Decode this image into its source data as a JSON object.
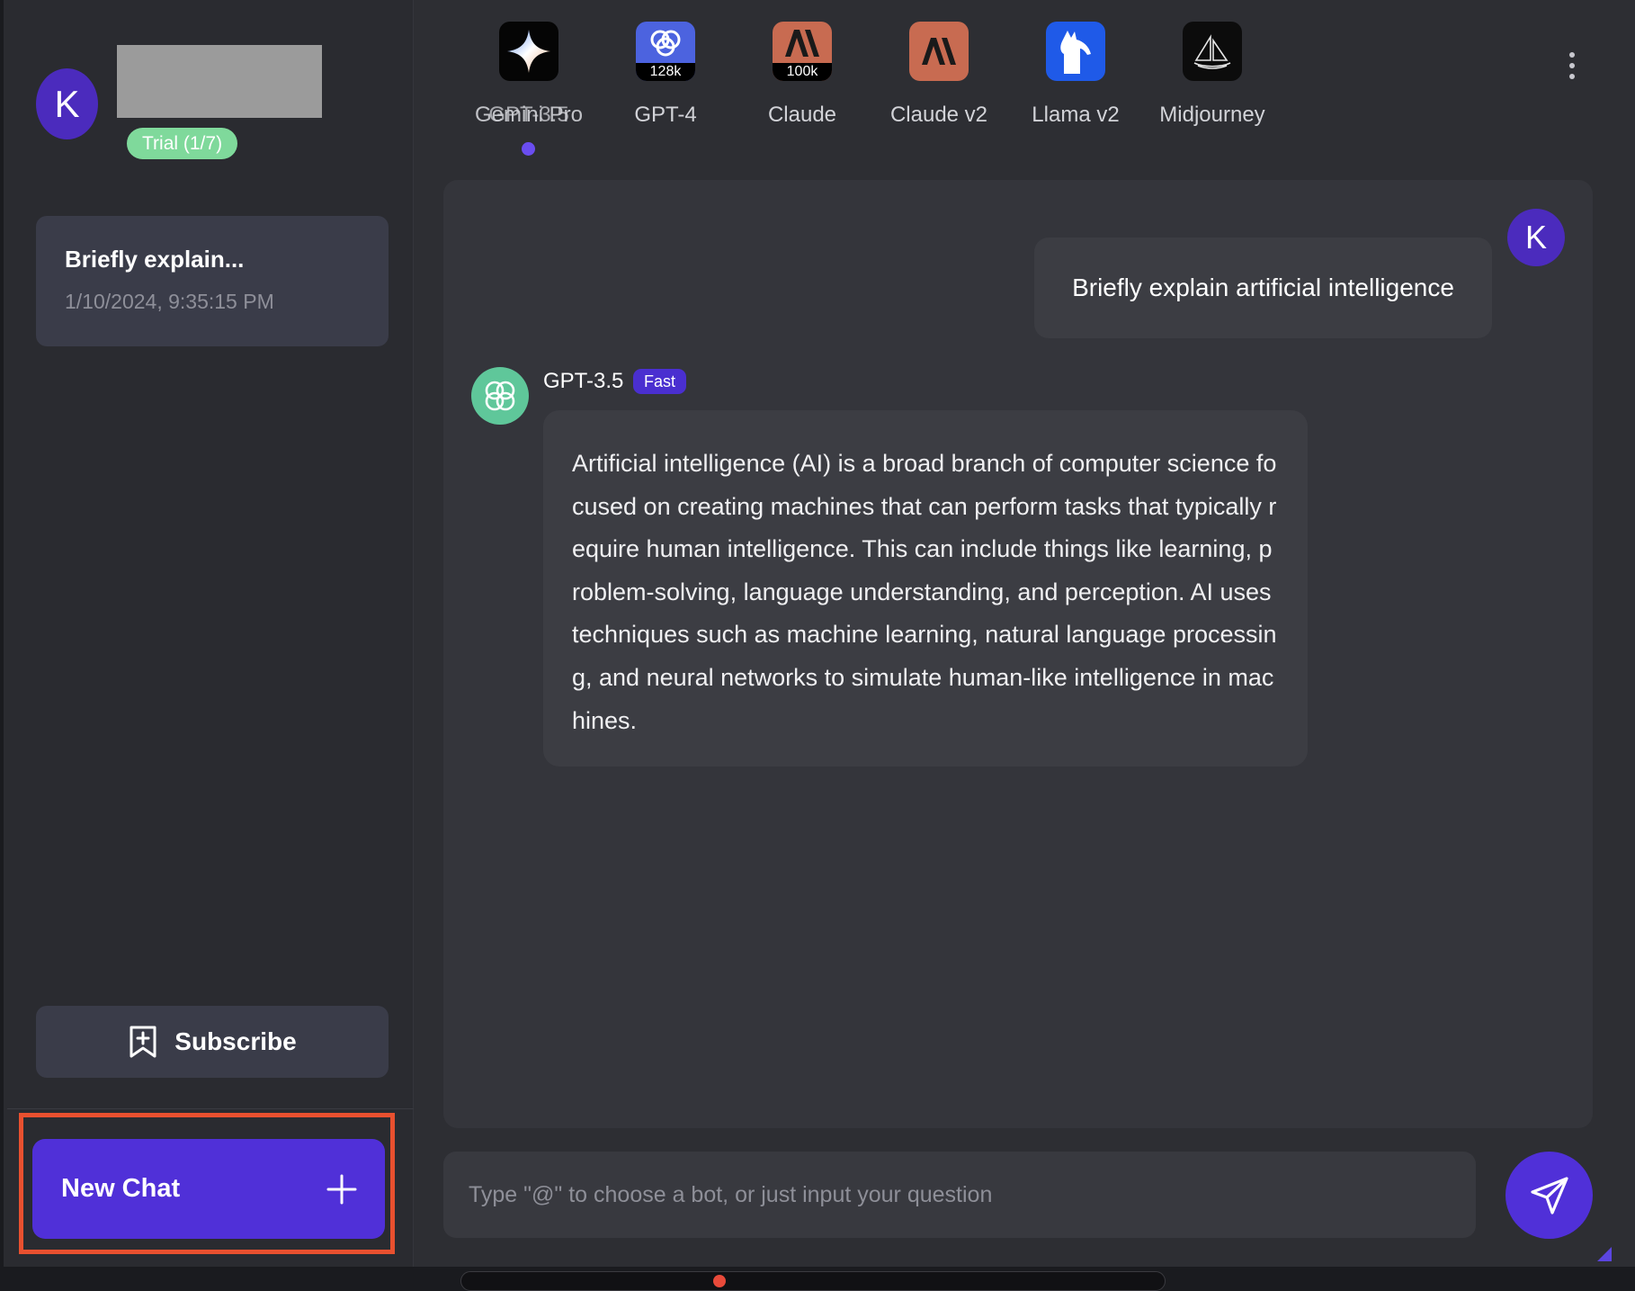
{
  "colors": {
    "accent": "#5030d8",
    "highlight_border": "#e8502f",
    "trial_badge": "#7fd99b",
    "avatar": "#4b2bbd",
    "gpt_green": "#5fc79a"
  },
  "sidebar": {
    "profile": {
      "avatar_letter": "K",
      "trial_badge": "Trial (1/7)"
    },
    "history": [
      {
        "title": "Briefly explain...",
        "time": "1/10/2024, 9:35:15 PM"
      }
    ],
    "subscribe_label": "Subscribe",
    "new_chat_label": "New Chat"
  },
  "bots": [
    {
      "label_a": "Gemini Pro",
      "label_b": "GPT-3.5",
      "icon": "gemini-sparkle-icon",
      "active": true
    },
    {
      "label": "GPT-4",
      "context": "128k",
      "icon": "openai-logo-icon"
    },
    {
      "label": "Claude",
      "context": "100k",
      "icon": "anthropic-logo-icon"
    },
    {
      "label": "Claude v2",
      "icon": "anthropic-logo-icon"
    },
    {
      "label": "Llama v2",
      "icon": "llama-icon"
    },
    {
      "label": "Midjourney",
      "icon": "sailboat-icon"
    }
  ],
  "chat": {
    "user_avatar_letter": "K",
    "user_message": "Briefly explain artificial intelligence",
    "bot_name": "GPT-3.5",
    "bot_badge": "Fast",
    "bot_message": "Artificial intelligence (AI) is a broad branch of computer science focused on creating machines that can perform tasks that typically require human intelligence. This can include things like learning, problem-solving, language understanding, and perception. AI uses techniques such as machine learning, natural language processing, and neural networks to simulate human-like intelligence in machines."
  },
  "composer": {
    "placeholder": "Type \"@\" to choose a bot, or just input your question"
  }
}
